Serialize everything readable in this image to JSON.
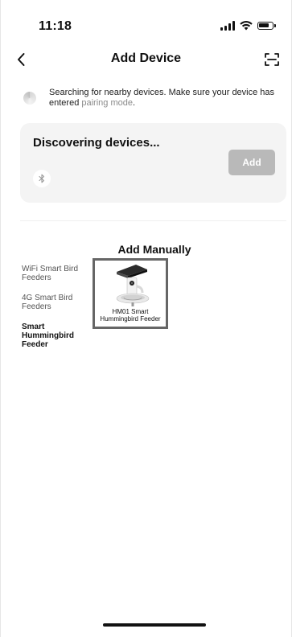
{
  "status_bar": {
    "time": "11:18"
  },
  "nav": {
    "title": "Add Device"
  },
  "search": {
    "message": "Searching for nearby devices. Make sure your device has entered ",
    "highlight": "pairing mode",
    "suffix": "."
  },
  "discover": {
    "title": "Discovering devices...",
    "add_label": "Add"
  },
  "add_manually": {
    "title": "Add Manually",
    "categories": [
      {
        "label": "WiFi Smart Bird Feeders",
        "active": false
      },
      {
        "label": "4G Smart Bird Feeders",
        "active": false
      },
      {
        "label": "Smart Hummingbird Feeder",
        "active": true
      }
    ],
    "products": [
      {
        "label": "HM01 Smart Hummingbird Feeder"
      }
    ]
  },
  "icons": {
    "back": "chevron-left-icon",
    "scan": "scan-icon",
    "bluetooth": "bluetooth-icon",
    "signal": "signal-icon",
    "wifi": "wifi-icon",
    "battery": "battery-icon"
  },
  "colors": {
    "add_button_bg": "#b9b9b9",
    "card_bg": "#f4f4f4",
    "highlight_text": "#8a8a8a",
    "product_border": "#666666"
  }
}
